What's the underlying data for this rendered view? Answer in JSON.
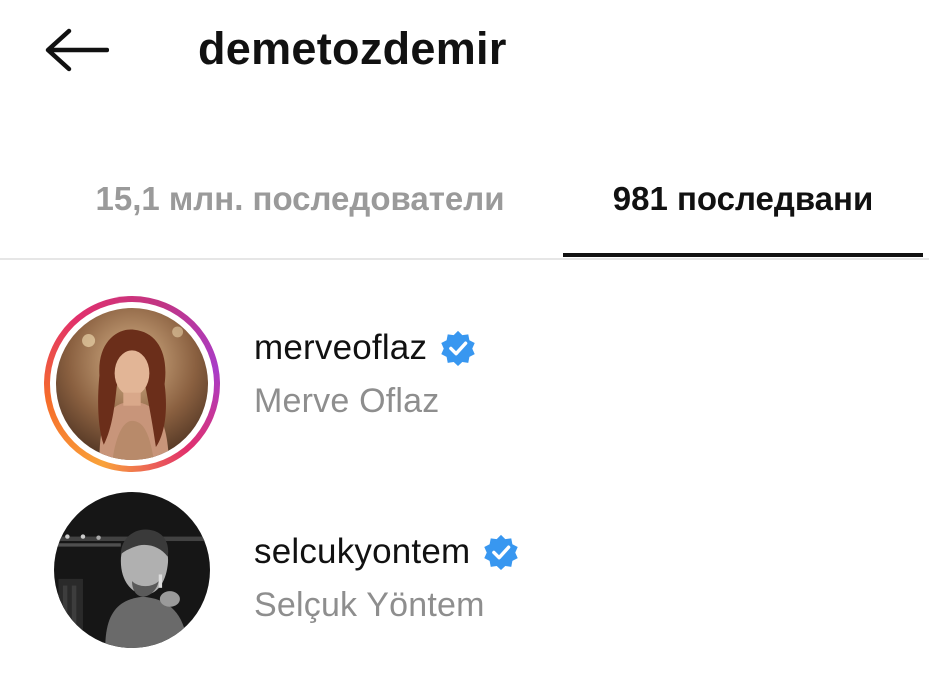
{
  "header": {
    "title": "demetozdemir",
    "back_icon": "arrow-left-icon"
  },
  "tabs": [
    {
      "label": "15,1 млн. последователи",
      "active": false
    },
    {
      "label": "981 последвани",
      "active": true
    }
  ],
  "accounts": [
    {
      "username": "merveoflaz",
      "full_name": "Merve Oflaz",
      "verified": true,
      "has_story": true
    },
    {
      "username": "selcukyontem",
      "full_name": "Selçuk Yöntem",
      "verified": true,
      "has_story": false
    }
  ],
  "colors": {
    "verified_blue": "#3897f0",
    "inactive_tab": "#9a9a9a",
    "secondary_text": "#8e8e8e"
  }
}
